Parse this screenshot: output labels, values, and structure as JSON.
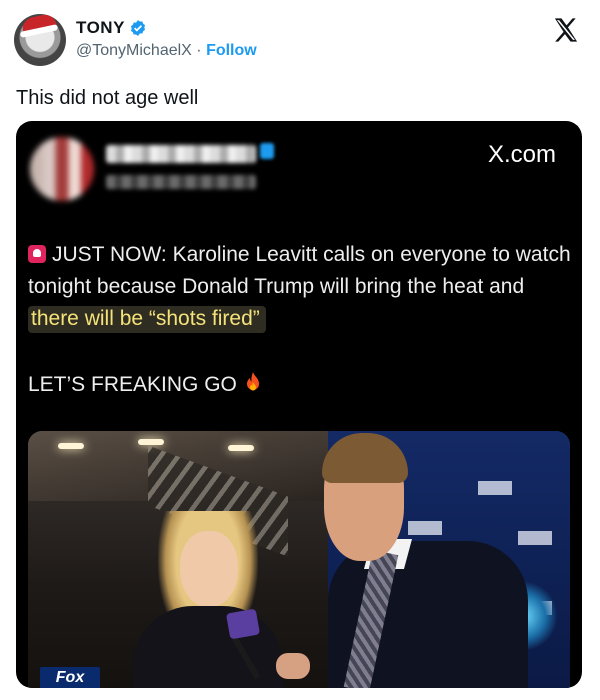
{
  "tweet": {
    "display_name": "TONY",
    "handle": "@TonyMichaelX",
    "separator": " · ",
    "follow_label": "Follow",
    "text": "This did not age well"
  },
  "embedded_post": {
    "domain": "X.com",
    "line_before_highlight": "JUST NOW: Karoline Leavitt calls on everyone to watch tonight because Donald Trump will bring the heat and ",
    "highlight": "there will be “shots fired”",
    "exclaim": "LET’S FREAKING GO",
    "video_logo": "Fox"
  },
  "icons": {
    "verified": "verified-badge-icon",
    "platform": "x-logo-icon",
    "siren": "rotating-light-icon",
    "fire": "fire-icon"
  },
  "colors": {
    "follow": "#1d9bf0",
    "embed_bg": "#000000",
    "highlight_text": "#f4e27a"
  }
}
